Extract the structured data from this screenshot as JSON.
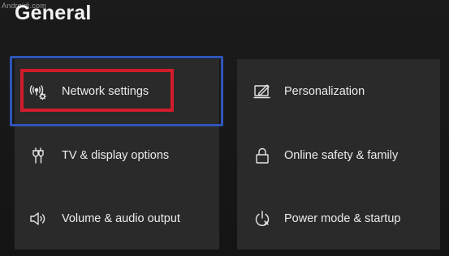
{
  "watermark": "Androidi.com",
  "page": {
    "title": "General"
  },
  "tiles": {
    "network": {
      "label": "Network settings",
      "icon": "wireless-gear-icon"
    },
    "personalization": {
      "label": "Personalization",
      "icon": "pen-monitor-icon"
    },
    "tv_display": {
      "label": "TV & display options",
      "icon": "hdmi-connector-icon"
    },
    "online_safety": {
      "label": "Online safety & family",
      "icon": "lock-icon"
    },
    "volume_audio": {
      "label": "Volume & audio output",
      "icon": "speaker-icon"
    },
    "power_mode": {
      "label": "Power mode & startup",
      "icon": "power-icon"
    }
  },
  "colors": {
    "background": "#161616",
    "tile": "#2a2a2a",
    "focus_ring": "#2f55b8",
    "highlight": "#d21c2c",
    "text": "#ececec"
  }
}
